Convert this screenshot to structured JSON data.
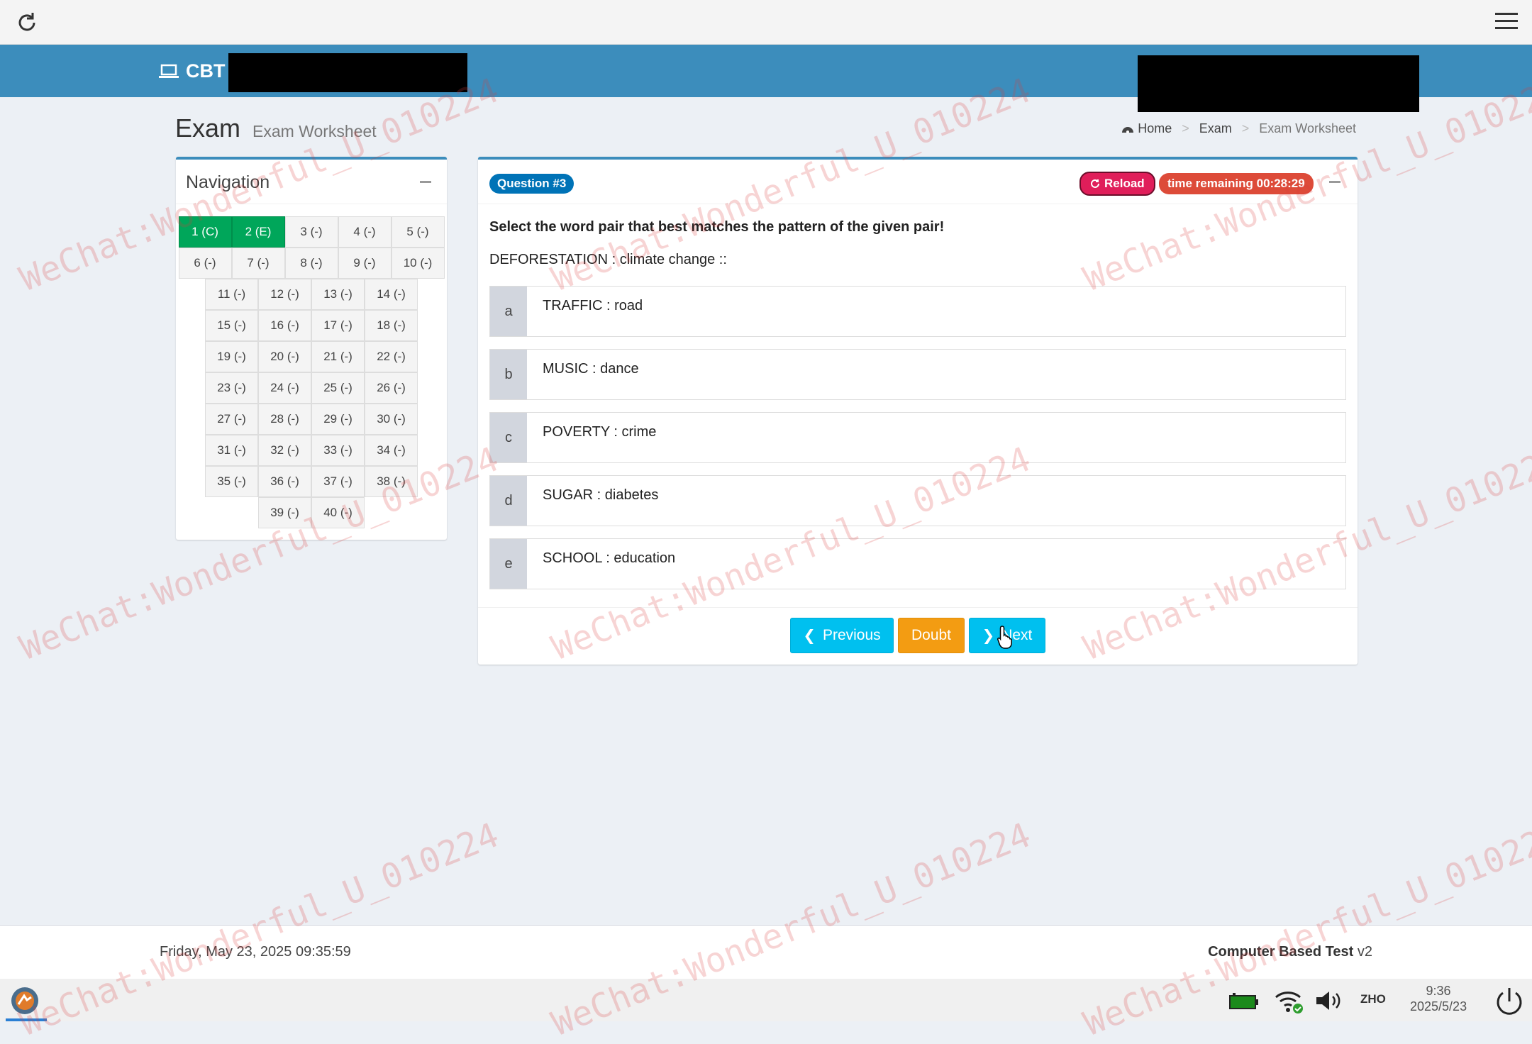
{
  "header": {
    "brand": "CBT"
  },
  "page": {
    "title": "Exam",
    "subtitle": "Exam Worksheet"
  },
  "breadcrumb": {
    "home": "Home",
    "exam": "Exam",
    "current": "Exam Worksheet"
  },
  "navigation": {
    "title": "Navigation",
    "rows": [
      [
        {
          "label": "1 (C)",
          "answered": true
        },
        {
          "label": "2 (E)",
          "answered": true
        },
        {
          "label": "3 (-)"
        },
        {
          "label": "4 (-)"
        },
        {
          "label": "5 (-)"
        }
      ],
      [
        {
          "label": "6 (-)"
        },
        {
          "label": "7 (-)"
        },
        {
          "label": "8 (-)"
        },
        {
          "label": "9 (-)"
        },
        {
          "label": "10 (-)"
        }
      ],
      [
        {
          "label": "11 (-)"
        },
        {
          "label": "12 (-)"
        },
        {
          "label": "13 (-)"
        },
        {
          "label": "14 (-)"
        }
      ],
      [
        {
          "label": "15 (-)"
        },
        {
          "label": "16 (-)"
        },
        {
          "label": "17 (-)"
        },
        {
          "label": "18 (-)"
        }
      ],
      [
        {
          "label": "19 (-)"
        },
        {
          "label": "20 (-)"
        },
        {
          "label": "21 (-)"
        },
        {
          "label": "22 (-)"
        }
      ],
      [
        {
          "label": "23 (-)"
        },
        {
          "label": "24 (-)"
        },
        {
          "label": "25 (-)"
        },
        {
          "label": "26 (-)"
        }
      ],
      [
        {
          "label": "27 (-)"
        },
        {
          "label": "28 (-)"
        },
        {
          "label": "29 (-)"
        },
        {
          "label": "30 (-)"
        }
      ],
      [
        {
          "label": "31 (-)"
        },
        {
          "label": "32 (-)"
        },
        {
          "label": "33 (-)"
        },
        {
          "label": "34 (-)"
        }
      ],
      [
        {
          "label": "35 (-)"
        },
        {
          "label": "36 (-)"
        },
        {
          "label": "37 (-)"
        },
        {
          "label": "38 (-)"
        }
      ],
      [
        {
          "label": "39 (-)"
        },
        {
          "label": "40 (-)"
        }
      ]
    ]
  },
  "question": {
    "badge": "Question #3",
    "reload_label": "Reload",
    "time_label": "time remaining 00:28:29",
    "instruction": "Select the word pair that best matches the pattern of the given pair!",
    "pair": "DEFORESTATION : climate change ::",
    "options": [
      {
        "letter": "a",
        "text": "TRAFFIC : road"
      },
      {
        "letter": "b",
        "text": "MUSIC : dance"
      },
      {
        "letter": "c",
        "text": "POVERTY : crime"
      },
      {
        "letter": "d",
        "text": "SUGAR : diabetes"
      },
      {
        "letter": "e",
        "text": "SCHOOL : education"
      }
    ],
    "prev_label": "Previous",
    "doubt_label": "Doubt",
    "next_label": "Next"
  },
  "footer": {
    "datetime": "Friday, May 23, 2025 09:35:59",
    "app_name": "Computer Based Test",
    "version": "v2"
  },
  "taskbar": {
    "lang": "ZHO",
    "time": "9:36",
    "date": "2025/5/23"
  },
  "watermark": "WeChat:Wonderful_U_010224",
  "colors": {
    "header": "#3c8dbc",
    "answered": "#00a65a",
    "info": "#00c0ef",
    "warning": "#f39c12",
    "danger": "#dd4b39"
  }
}
